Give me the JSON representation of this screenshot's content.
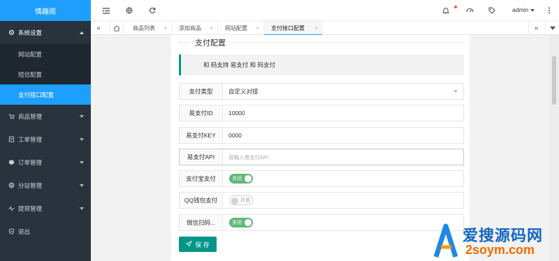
{
  "sidebar": {
    "logo": "情趣阁",
    "groups": [
      {
        "label": "系统设置",
        "icon": "gear-icon",
        "open": true,
        "children": [
          {
            "label": "网站配置"
          },
          {
            "label": "短信配置"
          },
          {
            "label": "支付接口配置",
            "active": true
          }
        ]
      },
      {
        "label": "商品管理",
        "icon": "cart-icon"
      },
      {
        "label": "工单管理",
        "icon": "ticket-icon"
      },
      {
        "label": "订单管理",
        "icon": "cube-icon"
      },
      {
        "label": "分站管理",
        "icon": "globe-icon"
      },
      {
        "label": "提现管理",
        "icon": "pulse-icon"
      },
      {
        "label": "退出",
        "icon": "shield-icon"
      }
    ]
  },
  "topbar": {
    "user": "admin"
  },
  "tabs": [
    {
      "label": "商品列表"
    },
    {
      "label": "添加商品"
    },
    {
      "label": "网站配置"
    },
    {
      "label": "支付接口配置",
      "active": true
    }
  ],
  "form": {
    "title": "支付配置",
    "notice": "和 码支持 易支付 和 码支付",
    "fields": [
      {
        "label": "支付类型",
        "value": "自定义对接"
      },
      {
        "label": "易支付ID",
        "value": "10000"
      },
      {
        "label": "易支付KEY",
        "value": "0000"
      },
      {
        "label": "易支付API",
        "placeholder": "请输入易支付API"
      },
      {
        "label": "支付宝支付",
        "switch_text": "关闭"
      },
      {
        "label": "QQ钱包支付",
        "switch_text": "开启"
      },
      {
        "label": "微信扫码...",
        "switch_text": "关闭"
      }
    ],
    "save_label": "保 存"
  },
  "watermark": {
    "line1": "爱搜源码网",
    "line2": "2soym.com"
  },
  "colors": {
    "accent": "#1e9fff",
    "sidebar": "#28333e",
    "primary_btn": "#009688",
    "switch_on": "#5fb878"
  }
}
